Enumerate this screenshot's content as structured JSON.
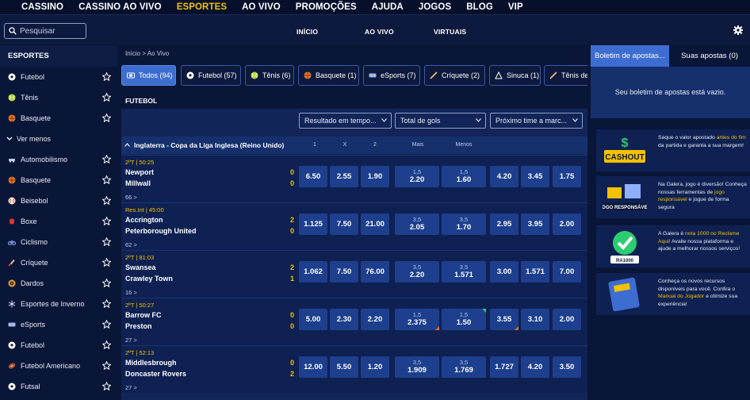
{
  "topnav": {
    "items": [
      {
        "label": "CASSINO",
        "active": false
      },
      {
        "label": "CASSINO AO VIVO",
        "active": false
      },
      {
        "label": "ESPORTES",
        "active": true
      },
      {
        "label": "AO VIVO",
        "active": false
      },
      {
        "label": "PROMOÇÕES",
        "active": false
      },
      {
        "label": "AJUDA",
        "active": false
      },
      {
        "label": "JOGOS",
        "active": false
      },
      {
        "label": "BLOG",
        "active": false
      },
      {
        "label": "VIP",
        "active": false
      }
    ]
  },
  "subbar": {
    "search_placeholder": "Pesquisar",
    "tabs": [
      "INÍCIO",
      "AO VIVO",
      "VIRTUAIS"
    ]
  },
  "sidebar": {
    "title": "ESPORTES",
    "top_items": [
      "Futebol",
      "Tênis",
      "Basquete"
    ],
    "see_less": "Ver menos",
    "items": [
      "Automobilismo",
      "Basquete",
      "Beisebol",
      "Boxe",
      "Ciclismo",
      "Críquete",
      "Dardos",
      "Esportes de Inverno",
      "eSports",
      "Futebol",
      "Futebol Americano",
      "Futsal"
    ]
  },
  "main": {
    "breadcrumb": "Início > Ao Vivo",
    "filters": [
      {
        "label": "Todos (94)",
        "active": true
      },
      {
        "label": "Futebol (57)",
        "active": false
      },
      {
        "label": "Tênis (6)",
        "active": false
      },
      {
        "label": "Basquete (1)",
        "active": false
      },
      {
        "label": "eSports (7)",
        "active": false
      },
      {
        "label": "Críquete (2)",
        "active": false
      },
      {
        "label": "Sinuca (1)",
        "active": false
      },
      {
        "label": "Tênis de",
        "active": false
      }
    ],
    "sport_title": "FUTEBOL",
    "selects": [
      "Resultado em tempo...",
      "Total de gols",
      "Próximo time a marc..."
    ],
    "league": "Inglaterra - Copa da Liga Inglesa (Reino Unido)",
    "columns": [
      "1",
      "X",
      "2",
      "Mais",
      "Menos"
    ],
    "matches": [
      {
        "time": "2ºT | 50:25",
        "home": "Newport",
        "away": "Millwall",
        "hs": "0",
        "as": "0",
        "more": "66 >",
        "odds": [
          "6.50",
          "2.55",
          "1.90"
        ],
        "ou_line": "1,5",
        "over": "2.20",
        "under": "1.60",
        "next": [
          "4.20",
          "3.45",
          "1.75"
        ]
      },
      {
        "time": "Res.Int | 45:00",
        "home": "Accrington",
        "away": "Peterborough United",
        "hs": "2",
        "as": "0",
        "more": "62 >",
        "odds": [
          "1.125",
          "7.50",
          "21.00"
        ],
        "ou_line": "3,5",
        "over": "2.05",
        "under": "1.70",
        "next": [
          "2.95",
          "3.95",
          "2.00"
        ]
      },
      {
        "time": "2ºT | 81:03",
        "home": "Swansea",
        "away": "Crawley Town",
        "hs": "2",
        "as": "1",
        "more": "16 >",
        "odds": [
          "1.062",
          "7.50",
          "76.00"
        ],
        "ou_line": "3,5",
        "over": "2.20",
        "under": "1.571",
        "next": [
          "3.00",
          "1.571",
          "7.00"
        ]
      },
      {
        "time": "2ºT | 50:27",
        "home": "Barrow FC",
        "away": "Preston",
        "hs": "0",
        "as": "0",
        "more": "27 >",
        "odds": [
          "5.00",
          "2.30",
          "2.20"
        ],
        "ou_line": "1,5",
        "over": "2.375",
        "under": "1.50",
        "next": [
          "3.55",
          "3.10",
          "2.00"
        ]
      },
      {
        "time": "2ºT | 52:13",
        "home": "Middlesbrough",
        "away": "Doncaster Rovers",
        "hs": "0",
        "as": "2",
        "more": "27 >",
        "odds": [
          "12.00",
          "5.50",
          "1.20"
        ],
        "ou_line": "3,5",
        "over": "1.909",
        "under": "1.769",
        "next": [
          "1.727",
          "4.20",
          "3.50"
        ]
      }
    ]
  },
  "betslip": {
    "tab_betslip": "Boletim de apostas...",
    "tab_mybets": "Suas apostas (0)",
    "empty": "Seu boletim de apostas está vazio."
  },
  "promos": [
    {
      "img": "CASHOUT",
      "pre": "Saque o valor apostado ",
      "hl": "antes do fim",
      "post": " da partida e garanta a sua margem!"
    },
    {
      "img": "JOGO RESPONSÁVEL",
      "pre": "Na Galera, jogo é diversão! Conheça nossas ferramentas de ",
      "hl": "jogo responsável",
      "post": " e jogue de forma segura"
    },
    {
      "img": "RA1000 ReclameAQUI",
      "pre": "A Galera é ",
      "hl": "nota 1000 no Reclame Aqui!",
      "post": " Avalie nossa plataforma e ajude a melhorar nossos serviços!"
    },
    {
      "img": "MANUAL DO JOGADOR",
      "pre": "Conheça os novos recursos disponíveis para você. Confira o ",
      "hl": "Manual do Jogador",
      "post": " e otimize sua experiência!"
    }
  ],
  "colors": {
    "accent": "#3d6dd0",
    "highlight": "#f2c200",
    "bg": "#0a1638",
    "odd_bg": "#1d3f8d"
  },
  "icons": [
    "search-icon",
    "gear-icon",
    "star-icon",
    "soccer-ball-icon",
    "tennis-ball-icon",
    "basketball-icon",
    "chevron-down-icon",
    "chevron-up-icon"
  ]
}
